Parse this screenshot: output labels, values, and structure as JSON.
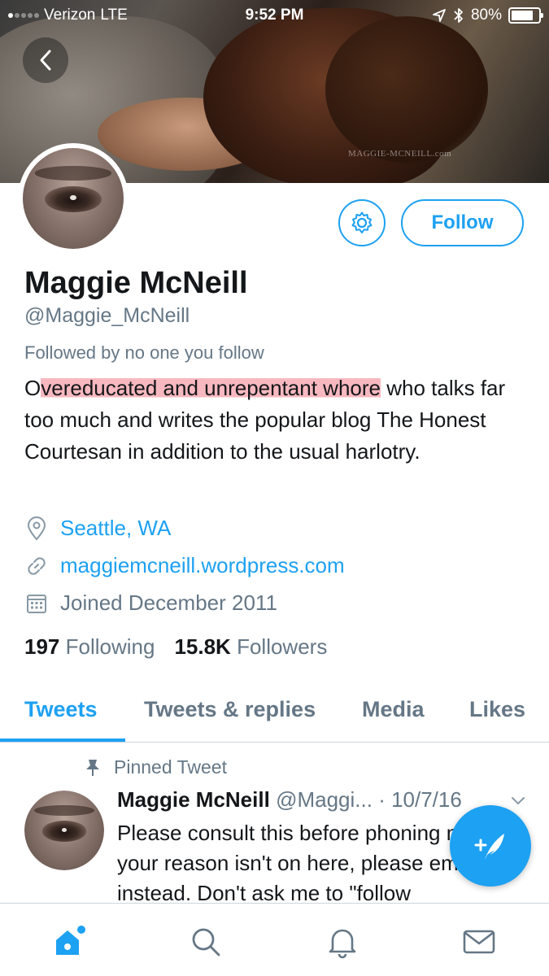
{
  "status_bar": {
    "carrier": "Verizon",
    "network": "LTE",
    "time": "9:52 PM",
    "battery": "80%",
    "battery_level": 0.8
  },
  "banner": {
    "watermark": "MAGGIE-MCNEILL.com"
  },
  "profile": {
    "name": "Maggie McNeill",
    "handle": "@Maggie_McNeill",
    "followed_by": "Followed by no one you follow",
    "bio_highlight_lead": "O",
    "bio_highlight": "vereducated and unrepentant whore",
    "bio_rest": " who talks far too much and writes the popular blog The Honest Courtesan in addition to the usual harlotry.",
    "location": "Seattle, WA",
    "website": "maggiemcneill.wordpress.com",
    "joined": "Joined December 2011",
    "following_count": "197",
    "following_label": "Following",
    "followers_count": "15.8K",
    "followers_label": "Followers"
  },
  "actions": {
    "follow_label": "Follow"
  },
  "tabs": [
    {
      "label": "Tweets",
      "active": true
    },
    {
      "label": "Tweets & replies",
      "active": false
    },
    {
      "label": "Media",
      "active": false
    },
    {
      "label": "Likes",
      "active": false
    }
  ],
  "tweet": {
    "pinned_label": "Pinned Tweet",
    "author": "Maggie McNeill",
    "handle": "@Maggi...",
    "date": "· 10/7/16",
    "text": "Please consult this before phoning me. If your reason isn't on here, please email instead. Don't ask me to \"follow"
  },
  "colors": {
    "accent": "#1da1f2",
    "secondary_text": "#657786",
    "highlight": "#f6a0aa"
  },
  "icons": {
    "back": "chevron-left-icon",
    "settings": "gear-icon",
    "location": "map-pin-icon",
    "link": "link-icon",
    "calendar": "calendar-icon",
    "pin": "pin-icon",
    "compose": "compose-icon",
    "home": "home-icon",
    "search": "search-icon",
    "notifications": "bell-icon",
    "messages": "envelope-icon"
  }
}
